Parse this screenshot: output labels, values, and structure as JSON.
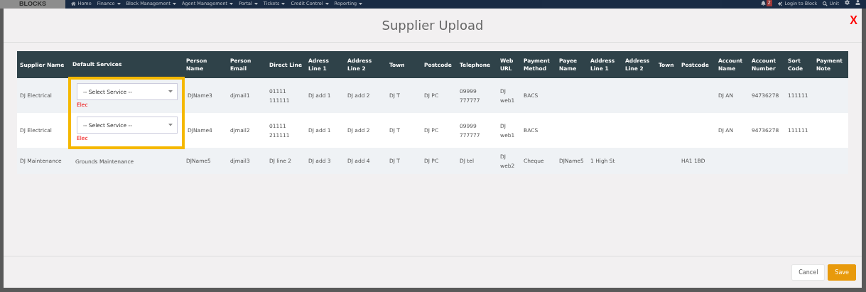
{
  "navbar": {
    "logo": "BLOCKS",
    "items": [
      {
        "label": "Home",
        "kind": "link"
      },
      {
        "label": "Finance",
        "kind": "dropdown"
      },
      {
        "label": "Block Management",
        "kind": "dropdown"
      },
      {
        "label": "Agent Management",
        "kind": "dropdown"
      },
      {
        "label": "Portal",
        "kind": "dropdown"
      },
      {
        "label": "Tickets",
        "kind": "dropdown"
      },
      {
        "label": "Credit Control",
        "kind": "dropdown"
      },
      {
        "label": "Reporting",
        "kind": "dropdown"
      }
    ],
    "notification_count": "2",
    "right_items": [
      {
        "label": "Login to Block",
        "kind": "login"
      },
      {
        "label": "Unit",
        "kind": "search"
      }
    ]
  },
  "modal": {
    "title": "Supplier Upload",
    "close": "X",
    "table": {
      "columns": [
        "Supplier Name",
        "Default Services",
        "Person Name",
        "Person Email",
        "Direct Line",
        "Adress Line 1",
        "Address Line 2",
        "Town",
        "Postcode",
        "Telephone",
        "Web URL",
        "Payment Method",
        "Payee Name",
        "Address Line 1",
        "Address Line 2",
        "Town",
        "Postcode",
        "Account Name",
        "Account Number",
        "Sort Code",
        "Payment Note"
      ],
      "rows": [
        {
          "cells": [
            "DJ Electrical",
            {
              "kind": "select",
              "placeholder": "-- Select Service --",
              "note": "Elec",
              "highlighted": true
            },
            "DJName3",
            "djmail1",
            "01111 111111",
            "DJ add 1",
            "DJ add 2",
            "DJ T",
            "DJ PC",
            "09999 777777",
            "DJ web1",
            "BACS",
            "",
            "",
            "",
            "",
            "",
            "DJ AN",
            "94736278",
            "111111",
            ""
          ]
        },
        {
          "cells": [
            "DJ Electrical",
            {
              "kind": "select",
              "placeholder": "-- Select Service --",
              "note": "Elec",
              "highlighted": true
            },
            "DJName4",
            "djmail2",
            "01111 211111",
            "DJ add 1",
            "DJ add 2",
            "DJ T",
            "DJ PC",
            "09999 777777",
            "DJ web1",
            "BACS",
            "",
            "",
            "",
            "",
            "",
            "DJ AN",
            "94736278",
            "111111",
            ""
          ]
        },
        {
          "cells": [
            "DJ Maintenance",
            {
              "kind": "text",
              "value": "Grounds Maintenance",
              "highlighted": false
            },
            "DJName5",
            "djmail3",
            "DJ line 2",
            "DJ add 3",
            "DJ add 4",
            "DJ T",
            "DJ PC",
            "DJ tel",
            "DJ web2",
            "Cheque",
            "DJName5",
            "1 High St",
            "",
            "",
            "HA1 1BD",
            "",
            "",
            "",
            ""
          ]
        }
      ]
    },
    "buttons": [
      {
        "label": "Cancel",
        "kind": "default"
      },
      {
        "label": "Save",
        "kind": "primary"
      }
    ]
  }
}
